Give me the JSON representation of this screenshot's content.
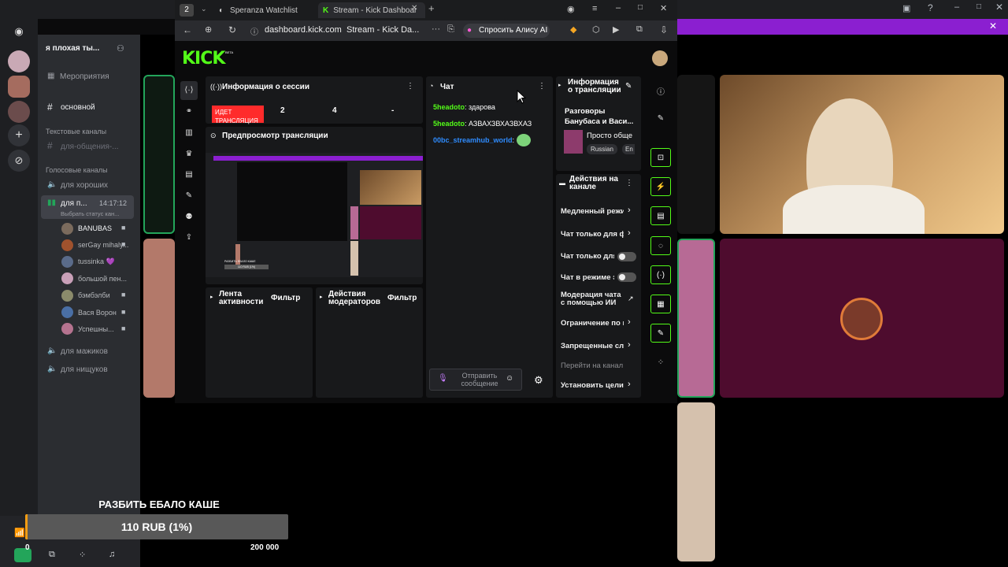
{
  "browser": {
    "tab_count": "2",
    "tabs": [
      {
        "label": "Speranza Watchlist"
      },
      {
        "label": "Stream - Kick Dashboar"
      }
    ],
    "url": "dashboard.kick.com",
    "page_title": "Stream - Kick Da...",
    "more": "···",
    "alice_label": "Спросить Алису AI"
  },
  "discord": {
    "server_name": "я плохая ты...",
    "events": "Мероприятия",
    "channel_main": "основной",
    "text_category": "Текстовые каналы",
    "text_channel": "для-общения-...",
    "voice_category": "Голосовые каналы",
    "voice_1": "для хороших",
    "voice_2": "для п...",
    "voice_2_timer": "14:17:12",
    "status_prompt": "Выбрать статус кан...",
    "users": [
      {
        "name": "BANUBAS"
      },
      {
        "name": "serGay mihaly..."
      },
      {
        "name": "tussinka 💜"
      },
      {
        "name": "большой пен..."
      },
      {
        "name": "бэмбэлби"
      },
      {
        "name": "Вася Ворон"
      },
      {
        "name": "Успешны..."
      }
    ],
    "voice_3": "для мажиков",
    "voice_4": "для нищуков"
  },
  "overlay": {
    "goal_title": "РАЗБИТЬ ЕБАЛО КАШЕ",
    "goal_amount": "110 RUB (1%)",
    "goal_min": "0",
    "goal_max": "200 000",
    "goal_progress_pct": 1
  },
  "kick": {
    "logo": "KICK",
    "logo_badge": "BETA",
    "session": {
      "title": "Информация о сессии",
      "live_badge": "ИДЕТ ТРАНСЛЯЦИЯ",
      "stat1": "2",
      "stat2": "4",
      "stat3": "-"
    },
    "preview": {
      "title": "Предпросмотр трансляции",
      "overlay_title": "РАЗБИТЬ ЕБАЛО КАШЕ",
      "overlay_amount": "110 RUB (1%)"
    },
    "activity": {
      "title": "Лента активности",
      "filter": "Фильтр"
    },
    "mod_actions": {
      "title": "Действия модераторов",
      "filter": "Фильтр"
    },
    "chat": {
      "title": "Чат",
      "messages": [
        {
          "user": "5headoto",
          "text": "здарова"
        },
        {
          "user": "5headoto",
          "text": "АЗВАХЗВХАЗВХАЗ"
        },
        {
          "user": "00bc_streamhub_world",
          "text": ""
        }
      ],
      "input_placeholder": "Отправить сообщение"
    },
    "stream_info": {
      "title": "Информация о трансляции",
      "stream_title": "Разговоры Банубаса и Васи...",
      "category": "Просто обще",
      "tags": [
        "Russian",
        "En"
      ]
    },
    "channel_actions": {
      "title": "Действия на канале",
      "items": [
        "Медленный режим",
        "Чат только для фолловеров",
        "Чат только для подписчиков",
        "Чат в режиме эмодзи",
        "Модерация чата с помощью ИИ",
        "Ограничение по времени",
        "Запрещенные слова",
        "Перейти на канал",
        "Установить цели"
      ]
    }
  },
  "colors": {
    "kick_green": "#53fc18",
    "live_red": "#ff2b2b",
    "discord_purple": "#8b1fd0"
  }
}
